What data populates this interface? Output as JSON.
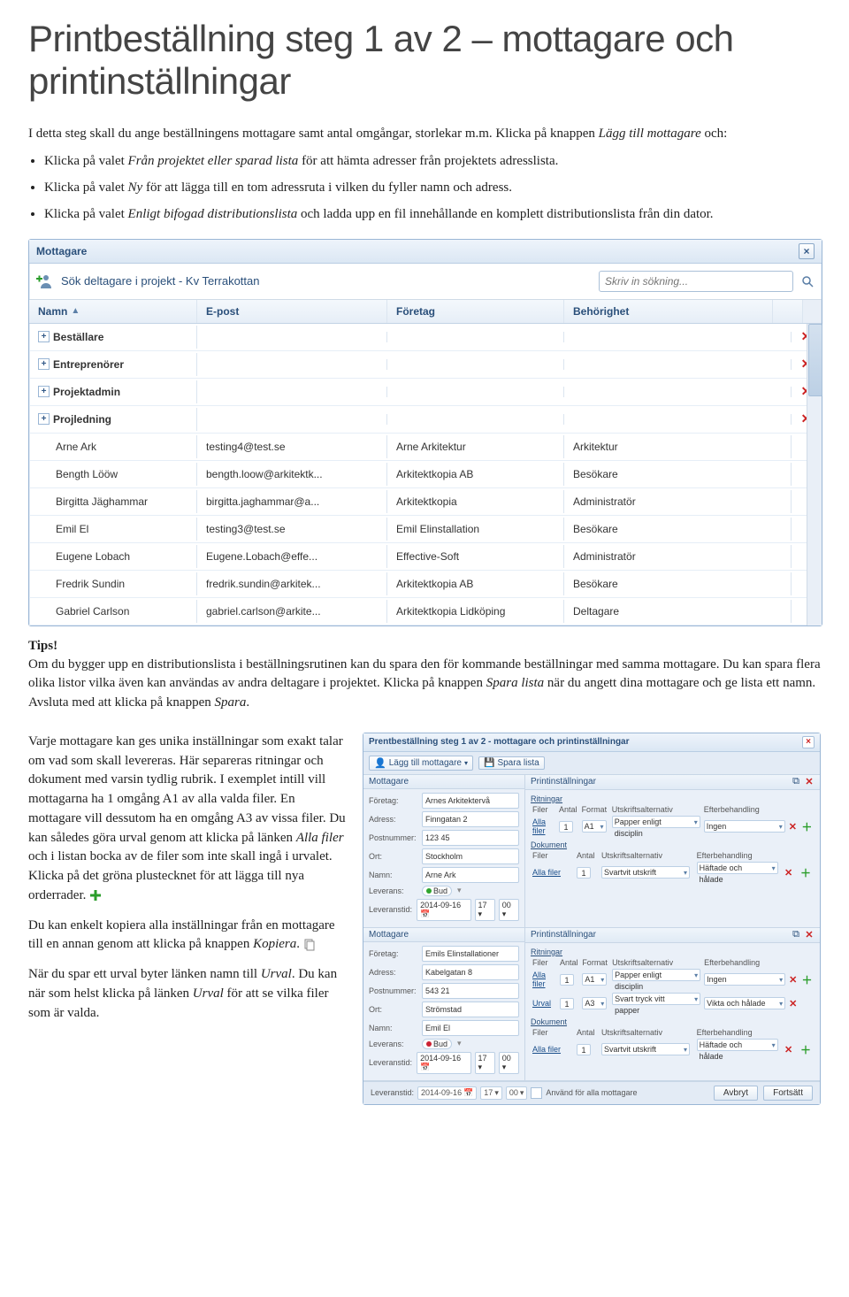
{
  "heading": "Printbeställning steg 1 av 2 – mottagare och printinställningar",
  "intro": "I detta steg skall du ange beställningens mottagare samt antal omgångar, storlekar m.m. Klicka på knappen Lägg till mottagare och:",
  "bullets": [
    "Klicka på valet Från projektet eller sparad lista för att hämta adresser från projektets adresslista.",
    "Klicka på valet Ny för att lägga till en tom adressruta i vilken du fyller namn och adress.",
    "Klicka på valet Enligt bifogad distributionslista och ladda upp en fil innehållande en komplett distributionslista från din dator."
  ],
  "dialog1": {
    "title": "Mottagare",
    "toolbar_label": "Sök deltagare i projekt - Kv Terrakottan",
    "search_placeholder": "Skriv in sökning...",
    "headers": {
      "name": "Namn",
      "email": "E-post",
      "company": "Företag",
      "role": "Behörighet"
    },
    "groups": [
      "Beställare",
      "Entreprenörer",
      "Projektadmin",
      "Projledning"
    ],
    "rows": [
      {
        "name": "Arne Ark",
        "email": "testing4@test.se",
        "company": "Arne Arkitektur",
        "role": "Arkitektur"
      },
      {
        "name": "Bength Lööw",
        "email": "bength.loow@arkitektk...",
        "company": "Arkitektkopia AB",
        "role": "Besökare"
      },
      {
        "name": "Birgitta Jäghammar",
        "email": "birgitta.jaghammar@a...",
        "company": "Arkitektkopia",
        "role": "Administratör"
      },
      {
        "name": "Emil El",
        "email": "testing3@test.se",
        "company": "Emil Elinstallation",
        "role": "Besökare"
      },
      {
        "name": "Eugene Lobach",
        "email": "Eugene.Lobach@effe...",
        "company": "Effective-Soft",
        "role": "Administratör"
      },
      {
        "name": "Fredrik Sundin",
        "email": "fredrik.sundin@arkitek...",
        "company": "Arkitektkopia AB",
        "role": "Besökare"
      },
      {
        "name": "Gabriel Carlson",
        "email": "gabriel.carlson@arkite...",
        "company": "Arkitektkopia Lidköping",
        "role": "Deltagare"
      }
    ]
  },
  "tips_head": "Tips!",
  "tips_body": "Om du bygger upp en distributionslista i beställningsrutinen kan du spara den för kommande beställningar med samma mottagare. Du kan spara flera olika listor vilka även kan användas av andra deltagare i projektet. Klicka på knappen Spara lista när du angett dina mottagare och ge lista ett namn. Avsluta med att klicka på knappen Spara.",
  "left_para1": "Varje mottagare kan ges unika inställningar som exakt talar om vad som skall levereras. Här separeras ritningar och dokument med varsin tydlig rubrik. I exemplet intill vill mottagarna ha 1 omgång A1 av alla valda filer. En mottagare vill dessutom ha en omgång A3 av vissa filer. Du kan således göra urval genom att klicka på länken Alla filer och i listan bocka av de filer som inte skall ingå i urvalet. Klicka på det gröna plustecknet för att lägga till nya orderrader.",
  "left_para2": "Du kan enkelt kopiera alla inställningar från en mottagare till en annan genom att klicka på knappen Kopiera.",
  "left_para3": "När du spar ett urval byter länken namn till Urval. Du kan när som helst klicka på länken Urval för att se vilka filer som är valda.",
  "dialog2": {
    "title": "Prentbeställning steg 1 av 2 - mottagare och printinställningar",
    "btn_add": "Lägg till mottagare",
    "btn_save": "Spara lista",
    "panel_mott_title": "Mottagare",
    "panel_print_title": "Printinställningar",
    "labels": {
      "company": "Företag:",
      "address": "Adress:",
      "postcode": "Postnummer:",
      "city": "Ort:",
      "name": "Namn:",
      "delivery": "Leverans:",
      "deliverytime": "Leveranstid:"
    },
    "subheads": {
      "drawings": "Ritningar",
      "documents": "Dokument"
    },
    "colheads": {
      "files": "Filer",
      "qty": "Antal",
      "format": "Format",
      "printalt": "Utskriftsalternativ",
      "finish": "Efterbehandling"
    },
    "all_files": "Alla filer",
    "urval": "Urval",
    "recipients": [
      {
        "company": "Arnes Arkitektervå",
        "address": "Finngatan 2",
        "postcode": "123 45",
        "city": "Stockholm",
        "name": "Arne Ark",
        "delivery": "Bud",
        "delivery_color": "#2fa52f",
        "deliverydate": "2014-09-16",
        "time_h": "17",
        "time_m": "00",
        "drawings": [
          {
            "files": "Alla filer",
            "qty": "1",
            "format": "A1",
            "printalt": "Papper enligt disciplin",
            "finish": "Ingen"
          }
        ],
        "documents": [
          {
            "files": "Alla filer",
            "qty": "1",
            "format": "",
            "printalt": "Svartvit utskrift",
            "finish": "Häftade och hålade"
          }
        ]
      },
      {
        "company": "Emils Elinstallationer",
        "address": "Kabelgatan 8",
        "postcode": "543 21",
        "city": "Strömstad",
        "name": "Emil El",
        "delivery": "Bud",
        "delivery_color": "#c23",
        "deliverydate": "2014-09-16",
        "time_h": "17",
        "time_m": "00",
        "drawings": [
          {
            "files": "Alla filer",
            "qty": "1",
            "format": "A1",
            "printalt": "Papper enligt disciplin",
            "finish": "Ingen"
          },
          {
            "files": "Urval",
            "qty": "1",
            "format": "A3",
            "printalt": "Svart tryck vitt papper",
            "finish": "Vikta och hålade"
          }
        ],
        "documents": [
          {
            "files": "Alla filer",
            "qty": "1",
            "format": "",
            "printalt": "Svartvit utskrift",
            "finish": "Häftade och hålade"
          }
        ]
      }
    ],
    "footer": {
      "leveranstid": "Leveranstid:",
      "date": "2014-09-16",
      "h": "17",
      "m": "00",
      "apply_all": "Använd för alla mottagare",
      "cancel": "Avbryt",
      "next": "Fortsätt"
    }
  }
}
